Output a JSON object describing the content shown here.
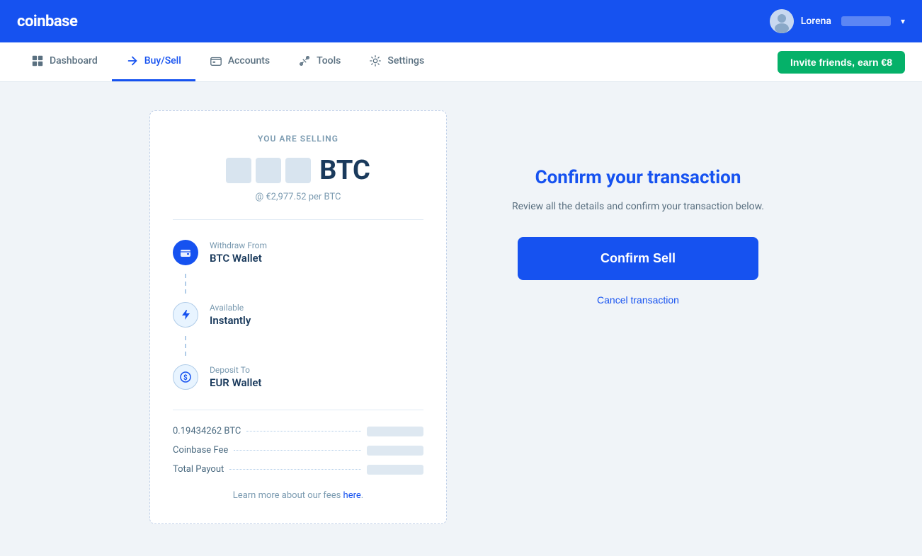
{
  "header": {
    "logo": "coinbase",
    "user": {
      "name": "Lorena",
      "chevron": "▾"
    }
  },
  "nav": {
    "items": [
      {
        "id": "dashboard",
        "label": "Dashboard",
        "active": false
      },
      {
        "id": "buy-sell",
        "label": "Buy/Sell",
        "active": true
      },
      {
        "id": "accounts",
        "label": "Accounts",
        "active": false
      },
      {
        "id": "tools",
        "label": "Tools",
        "active": false
      },
      {
        "id": "settings",
        "label": "Settings",
        "active": false
      }
    ],
    "invite_button": "Invite friends, earn €8"
  },
  "transaction": {
    "you_are_selling_label": "YOU ARE SELLING",
    "currency": "BTC",
    "price_per": "@ €2,977.52 per BTC",
    "withdraw_label": "Withdraw From",
    "withdraw_value": "BTC Wallet",
    "available_label": "Available",
    "available_value": "Instantly",
    "deposit_label": "Deposit To",
    "deposit_value": "EUR Wallet",
    "btc_amount_label": "0.19434262 BTC",
    "coinbase_fee_label": "Coinbase Fee",
    "total_payout_label": "Total Payout",
    "learn_more_text": "Learn more about our fees ",
    "learn_more_link": "here"
  },
  "confirm": {
    "title": "Confirm your transaction",
    "description": "Review all the details and confirm your transaction below.",
    "confirm_button": "Confirm Sell",
    "cancel_button": "Cancel transaction"
  }
}
